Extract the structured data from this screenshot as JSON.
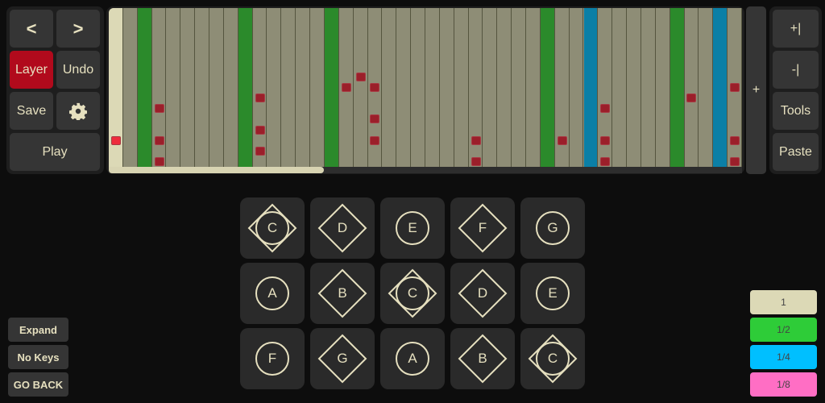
{
  "left_controls": {
    "prev_icon": "chevron-left-icon",
    "prev": "<",
    "next_icon": "chevron-right-icon",
    "next": ">",
    "layer": "Layer",
    "undo": "Undo",
    "save": "Save",
    "settings_icon": "gear-icon",
    "play": "Play"
  },
  "right_controls": {
    "add_bar": "+|",
    "remove_bar": "-|",
    "tools": "Tools",
    "paste": "Paste"
  },
  "add_column": "+",
  "sequencer": {
    "columns": 44,
    "rows": 15,
    "playhead_column": 0,
    "green_columns": [
      2,
      9,
      15,
      30,
      39
    ],
    "blue_columns": [
      33,
      42
    ],
    "notes": [
      [
        0,
        12
      ],
      [
        3,
        9
      ],
      [
        3,
        12
      ],
      [
        3,
        14
      ],
      [
        10,
        8
      ],
      [
        10,
        11
      ],
      [
        10,
        13
      ],
      [
        16,
        7
      ],
      [
        17,
        6
      ],
      [
        18,
        7
      ],
      [
        18,
        10
      ],
      [
        18,
        12
      ],
      [
        25,
        12
      ],
      [
        25,
        14
      ],
      [
        31,
        12
      ],
      [
        34,
        9
      ],
      [
        34,
        12
      ],
      [
        34,
        14
      ],
      [
        40,
        8
      ],
      [
        43,
        7
      ],
      [
        43,
        12
      ],
      [
        43,
        14
      ]
    ],
    "active_note": [
      0,
      12
    ],
    "scroll_fraction": 0.34,
    "colors": {
      "grid": "#8e8d76",
      "playhead": "#dcd9b6",
      "green": "#2b8a2b",
      "blue": "#0b7fa6",
      "note": "#9b1f2a"
    }
  },
  "pads": [
    [
      {
        "note": "C",
        "shape": "both"
      },
      {
        "note": "D",
        "shape": "diamond"
      },
      {
        "note": "E",
        "shape": "circle"
      },
      {
        "note": "F",
        "shape": "diamond"
      },
      {
        "note": "G",
        "shape": "circle"
      }
    ],
    [
      {
        "note": "A",
        "shape": "circle"
      },
      {
        "note": "B",
        "shape": "diamond"
      },
      {
        "note": "C",
        "shape": "both"
      },
      {
        "note": "D",
        "shape": "diamond"
      },
      {
        "note": "E",
        "shape": "circle"
      }
    ],
    [
      {
        "note": "F",
        "shape": "circle"
      },
      {
        "note": "G",
        "shape": "diamond"
      },
      {
        "note": "A",
        "shape": "circle"
      },
      {
        "note": "B",
        "shape": "diamond"
      },
      {
        "note": "C",
        "shape": "both"
      }
    ]
  ],
  "bottom_left": {
    "expand": "Expand",
    "no_keys": "No Keys",
    "go_back": "GO BACK"
  },
  "durations": [
    {
      "label": "1",
      "color": "#dcd9b6"
    },
    {
      "label": "1/2",
      "color": "#2ecc38"
    },
    {
      "label": "1/4",
      "color": "#00bfff"
    },
    {
      "label": "1/8",
      "color": "#ff6ec4"
    }
  ]
}
